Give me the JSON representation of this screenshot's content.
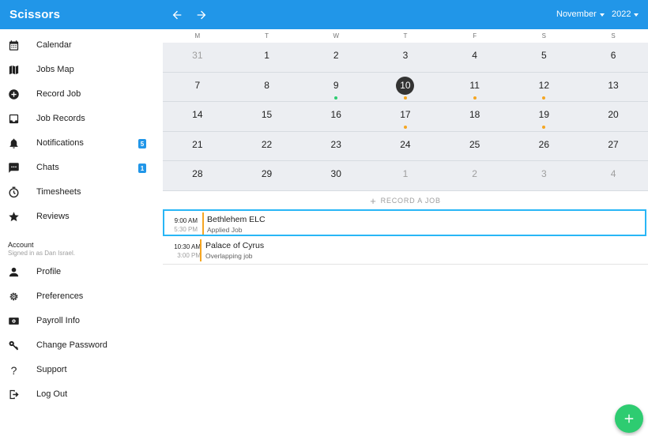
{
  "app": {
    "title": "Scissors",
    "month": "November",
    "year": "2022",
    "accent": "#2196e8"
  },
  "sidebar": {
    "items": [
      {
        "label": "Calendar",
        "icon": "calendar-icon"
      },
      {
        "label": "Jobs Map",
        "icon": "map-icon"
      },
      {
        "label": "Record Job",
        "icon": "add-circle-icon"
      },
      {
        "label": "Job Records",
        "icon": "inbox-icon"
      },
      {
        "label": "Notifications",
        "icon": "bell-icon",
        "badge": "5"
      },
      {
        "label": "Chats",
        "icon": "chat-icon",
        "badge": "1"
      },
      {
        "label": "Timesheets",
        "icon": "timer-icon"
      },
      {
        "label": "Reviews",
        "icon": "star-icon"
      }
    ],
    "account": {
      "title": "Account",
      "signed_in": "Signed in as Dan Israel.",
      "items": [
        {
          "label": "Profile",
          "icon": "person-icon"
        },
        {
          "label": "Preferences",
          "icon": "gear-icon"
        },
        {
          "label": "Payroll Info",
          "icon": "money-icon"
        },
        {
          "label": "Change Password",
          "icon": "key-icon"
        },
        {
          "label": "Support",
          "icon": "question-icon"
        },
        {
          "label": "Log Out",
          "icon": "logout-icon"
        }
      ]
    }
  },
  "calendar": {
    "weekdays": [
      "M",
      "T",
      "W",
      "T",
      "F",
      "S",
      "S"
    ],
    "weeks": [
      [
        {
          "d": "31",
          "other": true
        },
        {
          "d": "1"
        },
        {
          "d": "2"
        },
        {
          "d": "3"
        },
        {
          "d": "4"
        },
        {
          "d": "5"
        },
        {
          "d": "6"
        }
      ],
      [
        {
          "d": "7"
        },
        {
          "d": "8"
        },
        {
          "d": "9",
          "dot": "green"
        },
        {
          "d": "10",
          "today": true,
          "dot": "orange"
        },
        {
          "d": "11",
          "dot": "orange"
        },
        {
          "d": "12",
          "dot": "orange"
        },
        {
          "d": "13"
        }
      ],
      [
        {
          "d": "14"
        },
        {
          "d": "15"
        },
        {
          "d": "16"
        },
        {
          "d": "17",
          "dot": "orange"
        },
        {
          "d": "18"
        },
        {
          "d": "19",
          "dot": "orange"
        },
        {
          "d": "20"
        }
      ],
      [
        {
          "d": "21"
        },
        {
          "d": "22"
        },
        {
          "d": "23"
        },
        {
          "d": "24"
        },
        {
          "d": "25"
        },
        {
          "d": "26"
        },
        {
          "d": "27"
        }
      ],
      [
        {
          "d": "28"
        },
        {
          "d": "29"
        },
        {
          "d": "30"
        },
        {
          "d": "1",
          "other": true
        },
        {
          "d": "2",
          "other": true
        },
        {
          "d": "3",
          "other": true
        },
        {
          "d": "4",
          "other": true
        }
      ]
    ],
    "dot_colors": {
      "green": "#2ecc71",
      "orange": "#f5a623"
    },
    "record_label": "RECORD A JOB"
  },
  "jobs": [
    {
      "start": "9:00 AM",
      "end": "5:30 PM",
      "name": "Bethlehem ELC",
      "status": "Applied Job",
      "selected": true
    },
    {
      "start": "10:30 AM",
      "end": "3:00 PM",
      "name": "Palace of Cyrus",
      "status": "Overlapping job",
      "selected": false
    }
  ]
}
